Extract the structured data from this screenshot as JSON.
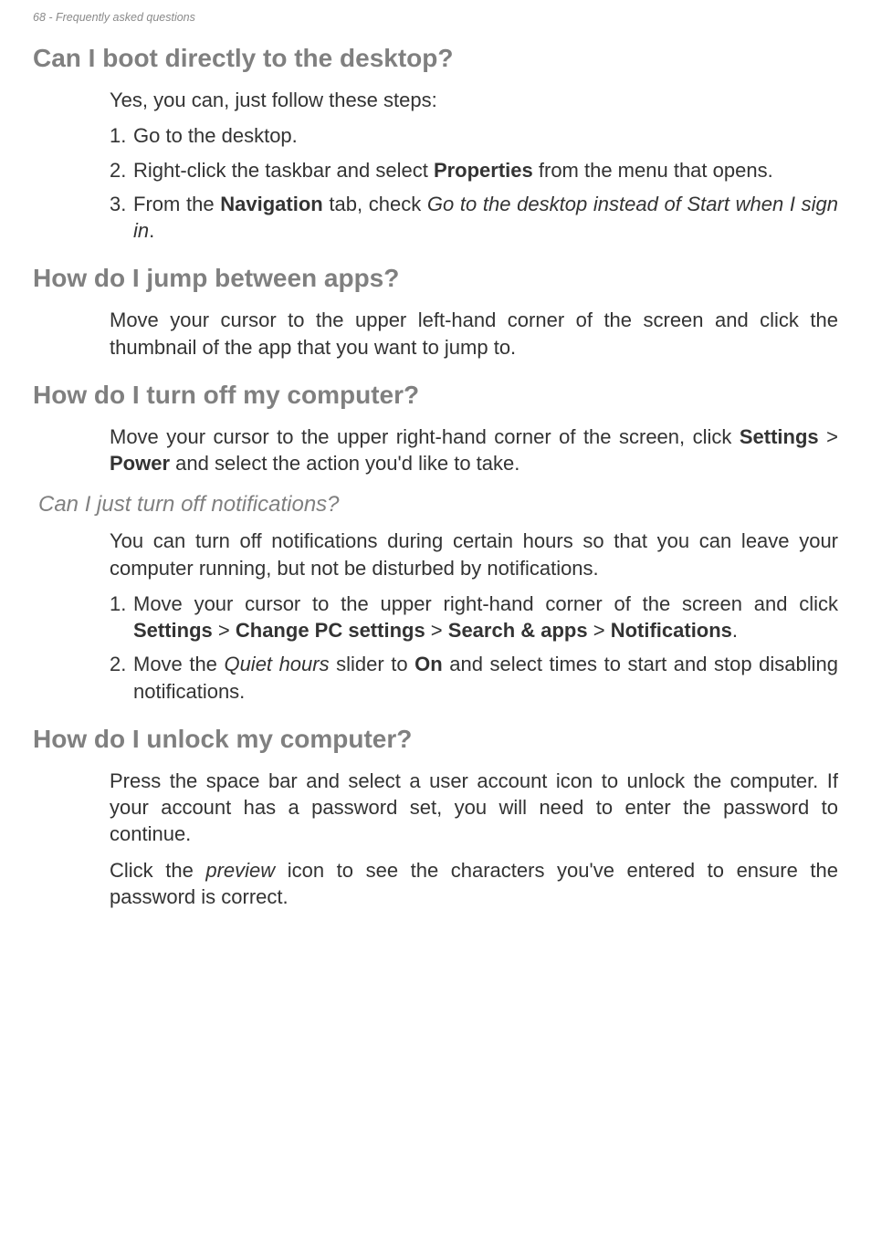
{
  "header": {
    "running": "68 - Frequently asked questions"
  },
  "s1": {
    "title": "Can I boot directly to the desktop?",
    "intro": "Yes, you can, just follow these steps:",
    "step1": "Go to the desktop.",
    "step2_a": "Right-click the taskbar and select ",
    "step2_b": "Properties",
    "step2_c": " from the menu that opens.",
    "step3_a": "From the ",
    "step3_b": "Navigation",
    "step3_c": " tab, check ",
    "step3_d": "Go to the desktop instead of Start when I sign in",
    "step3_e": "."
  },
  "s2": {
    "title": "How do I jump between apps?",
    "body": "Move your cursor to the upper left-hand corner of the screen and click the thumbnail of the app that you want to jump to."
  },
  "s3": {
    "title": "How do I turn off my computer?",
    "body_a": "Move your cursor to the upper right-hand corner of the screen, click ",
    "body_b": "Settings",
    "body_c": " > ",
    "body_d": "Power",
    "body_e": " and select the action you'd like to take."
  },
  "s3sub": {
    "title": "Can I just turn off notifications?",
    "body": "You can turn off notifications during certain hours so that you can leave your computer running, but not be disturbed by notifications.",
    "step1_a": "Move your cursor to the upper right-hand corner of the screen and click ",
    "step1_b": "Settings",
    "step1_c": " > ",
    "step1_d": "Change PC settings",
    "step1_e": " > ",
    "step1_f": "Search & apps",
    "step1_g": " > ",
    "step1_h": "Notifications",
    "step1_i": ".",
    "step2_a": "Move the ",
    "step2_b": "Quiet hours",
    "step2_c": " slider to ",
    "step2_d": "On",
    "step2_e": " and select times to start and stop disabling notifications."
  },
  "s4": {
    "title": "How do I unlock my computer?",
    "body1": "Press the space bar and select a user account icon to unlock the computer. If your account has a password set, you will need to enter the password to continue.",
    "body2_a": "Click the ",
    "body2_b": "preview",
    "body2_c": " icon to see the characters you've entered to ensure the password is correct."
  }
}
